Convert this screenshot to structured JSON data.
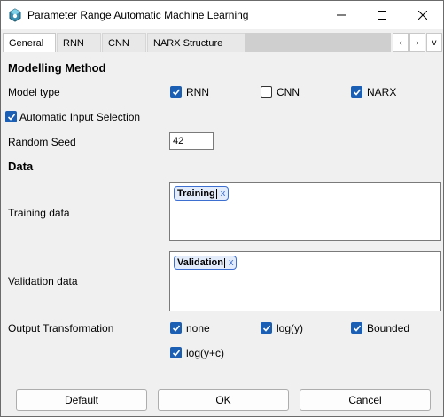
{
  "window": {
    "title": "Parameter Range Automatic Machine Learning",
    "app_icon": "gear-cube-icon",
    "controls": [
      "minimize-icon",
      "maximize-icon",
      "close-icon"
    ]
  },
  "tabs": [
    {
      "label": "General",
      "active": true
    },
    {
      "label": "RNN",
      "active": false
    },
    {
      "label": "CNN",
      "active": false
    },
    {
      "label": "NARX Structure",
      "active": false
    }
  ],
  "tab_nav": {
    "prev": "‹",
    "next": "›",
    "menu": "v"
  },
  "modelling": {
    "heading": "Modelling Method",
    "model_type_label": "Model type",
    "model_types": [
      {
        "label": "RNN",
        "checked": true
      },
      {
        "label": "CNN",
        "checked": false
      },
      {
        "label": "NARX",
        "checked": true
      }
    ],
    "auto_input_label": "Automatic Input Selection",
    "auto_input_checked": true,
    "random_seed_label": "Random Seed",
    "random_seed_value": "42"
  },
  "data": {
    "heading": "Data",
    "training_label": "Training data",
    "training_chip": "Training",
    "validation_label": "Validation data",
    "validation_chip": "Validation",
    "chip_remove": "x",
    "output_label": "Output Transformation",
    "transforms": [
      {
        "label": "none",
        "checked": true
      },
      {
        "label": "log(y)",
        "checked": true
      },
      {
        "label": "Bounded",
        "checked": true
      },
      {
        "label": "log(y+c)",
        "checked": true
      }
    ]
  },
  "buttons": {
    "default": "Default",
    "ok": "OK",
    "cancel": "Cancel"
  },
  "colors": {
    "accent": "#1a5fb4",
    "chip_border": "#3d6fd1"
  }
}
